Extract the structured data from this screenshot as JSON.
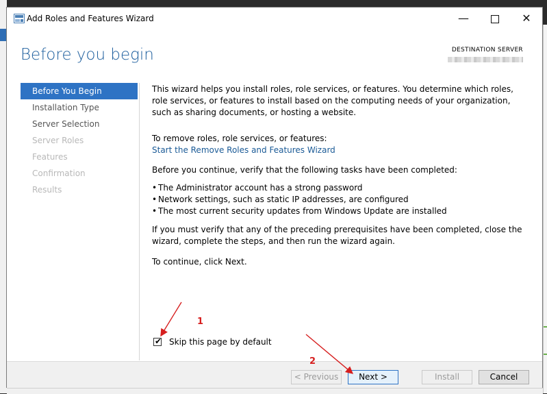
{
  "window": {
    "title": "Add Roles and Features Wizard"
  },
  "header": {
    "page_title": "Before you begin",
    "destination_label": "DESTINATION SERVER"
  },
  "nav": {
    "items": [
      {
        "label": "Before You Begin",
        "state": "active"
      },
      {
        "label": "Installation Type",
        "state": "normal"
      },
      {
        "label": "Server Selection",
        "state": "normal"
      },
      {
        "label": "Server Roles",
        "state": "disabled"
      },
      {
        "label": "Features",
        "state": "disabled"
      },
      {
        "label": "Confirmation",
        "state": "disabled"
      },
      {
        "label": "Results",
        "state": "disabled"
      }
    ]
  },
  "content": {
    "intro": "This wizard helps you install roles, role services, or features. You determine which roles, role services, or features to install based on the computing needs of your organization, such as sharing documents, or hosting a website.",
    "remove_text": "To remove roles, role services, or features:",
    "remove_link": "Start the Remove Roles and Features Wizard",
    "verify_text": "Before you continue, verify that the following tasks have been completed:",
    "bullets": [
      "The Administrator account has a strong password",
      "Network settings, such as static IP addresses, are configured",
      "The most current security updates from Windows Update are installed"
    ],
    "prereq_text": "If you must verify that any of the preceding prerequisites have been completed, close the wizard, complete the steps, and then run the wizard again.",
    "continue_text": "To continue, click Next.",
    "skip_label": "Skip this page by default",
    "skip_checked": true
  },
  "footer": {
    "previous": "< Previous",
    "next": "Next >",
    "install": "Install",
    "cancel": "Cancel"
  },
  "annotations": {
    "label_1": "1",
    "label_2": "2",
    "color": "#d61f1f"
  },
  "colors": {
    "accent": "#2e73c4",
    "title": "#1e5f9e",
    "link": "#1a5a96"
  }
}
